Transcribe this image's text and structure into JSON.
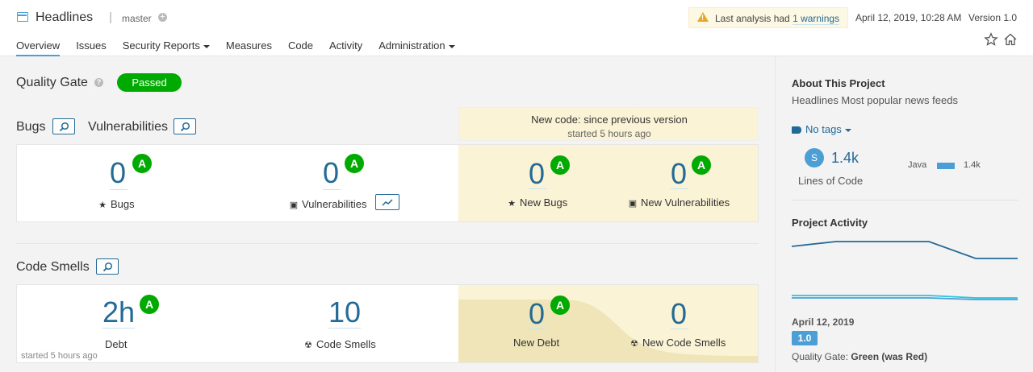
{
  "header": {
    "project_name": "Headlines",
    "branch": "master",
    "warning_prefix": "Last analysis had",
    "warning_link": "1 warnings",
    "analysis_date": "April 12, 2019, 10:28 AM",
    "version": "Version 1.0"
  },
  "nav": {
    "overview": "Overview",
    "issues": "Issues",
    "security_reports": "Security Reports",
    "measures": "Measures",
    "code": "Code",
    "activity": "Activity",
    "administration": "Administration"
  },
  "quality_gate": {
    "title": "Quality Gate",
    "status": "Passed"
  },
  "bugs_section": {
    "bugs_title": "Bugs",
    "vulnerabilities_title": "Vulnerabilities",
    "new_code_title": "New code: since previous version",
    "new_code_sub": "started 5 hours ago",
    "bugs_value": "0",
    "bugs_rating": "A",
    "bugs_label": "Bugs",
    "vuln_value": "0",
    "vuln_rating": "A",
    "vuln_label": "Vulnerabilities",
    "new_bugs_value": "0",
    "new_bugs_rating": "A",
    "new_bugs_label": "New Bugs",
    "new_vuln_value": "0",
    "new_vuln_rating": "A",
    "new_vuln_label": "New Vulnerabilities"
  },
  "smells_section": {
    "title": "Code Smells",
    "debt_value": "2h",
    "debt_rating": "A",
    "debt_label": "Debt",
    "smells_value": "10",
    "smells_label": "Code Smells",
    "new_debt_value": "0",
    "new_debt_rating": "A",
    "new_debt_label": "New Debt",
    "new_smells_value": "0",
    "new_smells_label": "New Code Smells",
    "started": "started 5 hours ago"
  },
  "sidebar": {
    "about_title": "About This Project",
    "description": "Headlines Most popular news feeds",
    "tags": "No tags",
    "loc_size": "S",
    "loc_value": "1.4k",
    "loc_label": "Lines of Code",
    "lang_name": "Java",
    "lang_value": "1.4k",
    "activity_title": "Project Activity",
    "activity_date": "April 12, 2019",
    "activity_version": "1.0",
    "qg_event_prefix": "Quality Gate:",
    "qg_event_value": "Green (was Red)"
  },
  "colors": {
    "accent": "#236a97",
    "passed": "#00aa00",
    "new_code_bg": "#fbf3d5"
  }
}
